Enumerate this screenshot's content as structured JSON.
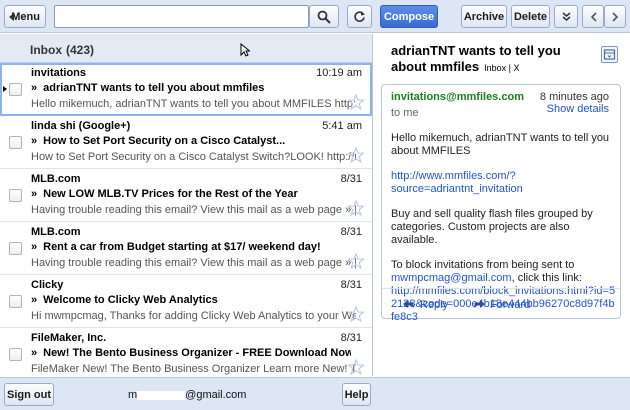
{
  "toolbar": {
    "menu_label": "Menu",
    "search_value": "",
    "compose_label": "Compose",
    "archive_label": "Archive",
    "delete_label": "Delete"
  },
  "inbox": {
    "title": "Inbox",
    "count": "(423)"
  },
  "messages": [
    {
      "sender": "invitations",
      "time": "10:19 am",
      "subject": "adrianTNT wants to tell you about mmfiles",
      "snippet": "Hello mikemuch, adrianTNT wants to tell you about MMFILES http://www.m..."
    },
    {
      "sender": "linda shi (Google+)",
      "time": "5:41 am",
      "subject": "How to Set Port Security on a Cisco Catalyst...",
      "snippet": "How to Set Port Security on a Cisco Catalyst Switch?LOOK! http://routerswi..."
    },
    {
      "sender": "MLB.com",
      "time": "8/31",
      "subject": "New LOW MLB.TV Prices for the Rest of the Year",
      "snippet": "Having trouble reading this email? View this mail as a web page » | View thi..."
    },
    {
      "sender": "MLB.com",
      "time": "8/31",
      "subject": "Rent a car from Budget starting at $17/ weekend day!",
      "snippet": "Having trouble reading this email? View this mail as a web page » | View thi..."
    },
    {
      "sender": "Clicky",
      "time": "8/31",
      "subject": "Welcome to Clicky Web Analytics",
      "snippet": "Hi mwmpcmag, Thanks for adding Clicky Web Analytics to your Webs.com ..."
    },
    {
      "sender": "FileMaker, Inc.",
      "time": "8/31",
      "subject": "New! The Bento Business Organizer - FREE Download Now!",
      "snippet": "FileMaker New! The Bento Business Organizer Learn more New! The Bento..."
    }
  ],
  "subject_marker": "»",
  "detail": {
    "title": "adrianTNT wants to tell you about mmfiles",
    "labels": "Inbox | X",
    "from": "invitations@mmfiles.com",
    "to": "to me",
    "ago": "8 minutes ago",
    "show_details": "Show details",
    "body_p1": "Hello mikemuch, adrianTNT wants to tell you about MMFILES",
    "body_link1": "http://www.mmfiles.com/?source=adriantnt_invitation",
    "body_p2": "Buy and sell quality flash files grouped by categories. Custom projects are also available.",
    "body_p3_intro": "To block invitations from being sent to",
    "body_p3_email": "mwmpcmag@gmail.com",
    "body_p3_mid": ", click this link:",
    "body_p3_link": "http://mmfiles.com/block_invitations.html?id=52128&code=000e4b18e444bb96270c8d97f4bfe8c3",
    "reply_label": "Reply",
    "forward_label": "Forward"
  },
  "footer": {
    "signout_label": "Sign out",
    "account_prefix": "m",
    "account_suffix": "@gmail.com",
    "help_label": "Help"
  },
  "colors": {
    "accent": "#3a6cd2",
    "link": "#2255cc",
    "sender_green": "#1b7f1b",
    "bar_bg": "#dde6f4"
  }
}
